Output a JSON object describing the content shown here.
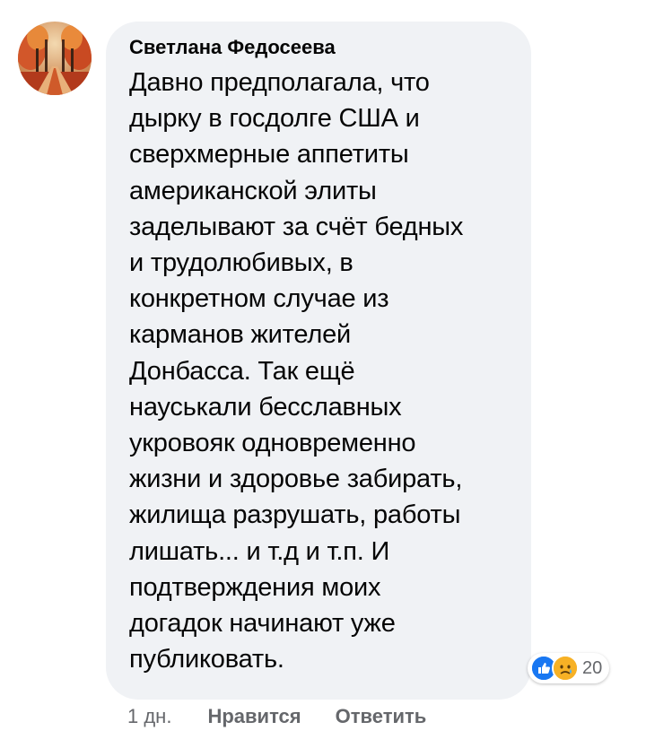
{
  "comment": {
    "author": "Светлана Федосеева",
    "text": "Давно предполагала,  что\nдырку в госдолге  США и\nсверхмерные аппетиты\nамериканской элиты\nзаделывают за счёт бедных\nи трудолюбивых, в\nконкретном случае из\nкарманов жителей\nДонбасса. Так ещё\nнауськали бесславных\nукровояк одновременно\nжизни и здоровье забирать,\nжилища разрушать, работы\nлишать... и т.д и т.п.  И\nподтверждения моих\nдогадок начинают уже\nпубликовать."
  },
  "reactions": {
    "icons": [
      "like-icon",
      "sad-icon"
    ],
    "count": "20",
    "colors": {
      "like": "#1877f2",
      "sad": "#f7b125"
    }
  },
  "actions": {
    "time": "1 дн.",
    "like_label": "Нравится",
    "reply_label": "Ответить"
  },
  "colors": {
    "bubble_bg": "#f0f2f5",
    "text": "#050505",
    "secondary": "#65676b"
  }
}
